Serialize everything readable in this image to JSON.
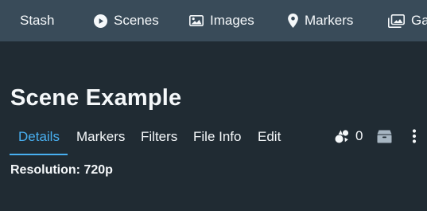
{
  "nav": {
    "brand": "Stash",
    "items": [
      {
        "label": "Scenes",
        "icon": "play-circle-icon"
      },
      {
        "label": "Images",
        "icon": "image-icon"
      },
      {
        "label": "Markers",
        "icon": "map-marker-icon"
      },
      {
        "label": "Ga",
        "icon": "images-icon"
      }
    ]
  },
  "scene": {
    "title": "Scene Example",
    "o_counter": "0",
    "resolution": "Resolution: 720p"
  },
  "tabs": [
    {
      "label": "Details",
      "active": true
    },
    {
      "label": "Markers"
    },
    {
      "label": "Filters"
    },
    {
      "label": "File Info"
    },
    {
      "label": "Edit"
    }
  ],
  "toolbar_icons": [
    "o-counter-icon",
    "box-icon",
    "more-vertical-icon"
  ],
  "colors": {
    "background": "#202b33",
    "navbar": "#394b59",
    "accent": "#48aff0",
    "text": "#f5f8fa",
    "icon_muted": "#a7b6c2"
  }
}
